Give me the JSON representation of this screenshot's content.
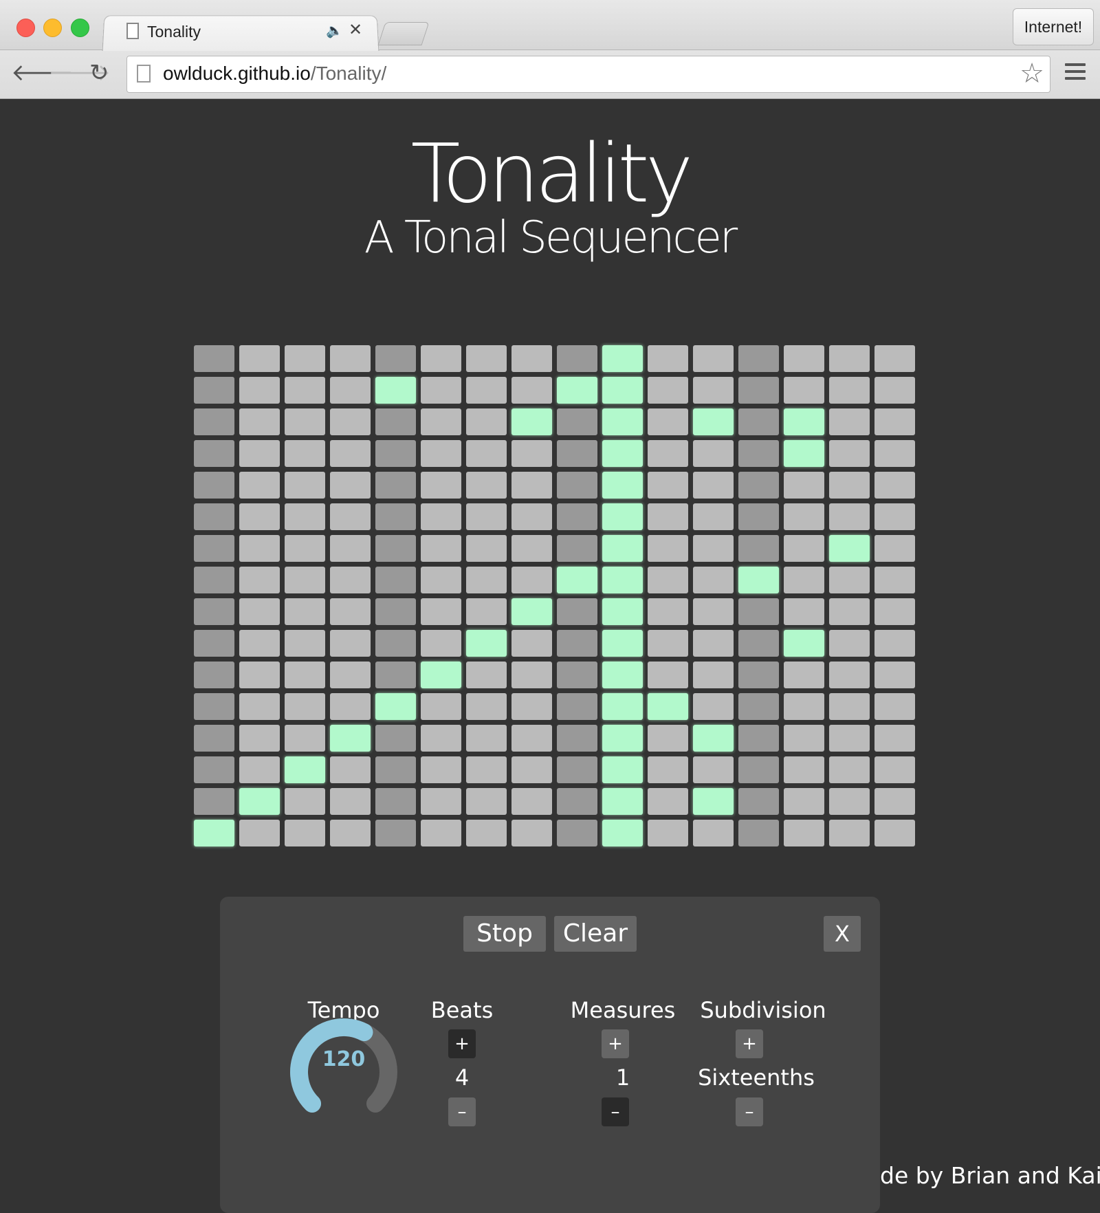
{
  "browser": {
    "tab_title": "Tonality",
    "profile_button": "Internet!",
    "url_host": "owlduck.github.io",
    "url_path": "/Tonality/"
  },
  "page": {
    "title": "Tonality",
    "subtitle": "A Tonal Sequencer",
    "credit": "de by Brian and Kai."
  },
  "sequencer": {
    "rows": 16,
    "cols": 16,
    "dark_columns": [
      0,
      4,
      8,
      12
    ],
    "active_by_column": [
      [
        15
      ],
      [
        14
      ],
      [
        13
      ],
      [
        12
      ],
      [
        1,
        11
      ],
      [
        10
      ],
      [
        9
      ],
      [
        2,
        8
      ],
      [
        1,
        7
      ],
      [
        0,
        1,
        2,
        3,
        4,
        5,
        6,
        7,
        8,
        9,
        10,
        11,
        12,
        13,
        14,
        15
      ],
      [
        11
      ],
      [
        2,
        12,
        14
      ],
      [
        7
      ],
      [
        2,
        3,
        9
      ],
      [
        6
      ],
      []
    ],
    "colors": {
      "cell": "#bbbbbb",
      "dark_cell": "#999999",
      "active_cell": "#b2f9cc"
    }
  },
  "controls": {
    "stop_label": "Stop",
    "clear_label": "Clear",
    "close_label": "X",
    "tempo": {
      "label": "Tempo",
      "value": "120",
      "level_fraction": 0.6
    },
    "beats": {
      "label": "Beats",
      "value": "4",
      "plus": "+",
      "minus": "–"
    },
    "measures": {
      "label": "Measures",
      "value": "1",
      "plus": "+",
      "minus": "–"
    },
    "subdivision": {
      "label": "Subdivision",
      "value": "Sixteenths",
      "plus": "+",
      "minus": "–"
    }
  }
}
